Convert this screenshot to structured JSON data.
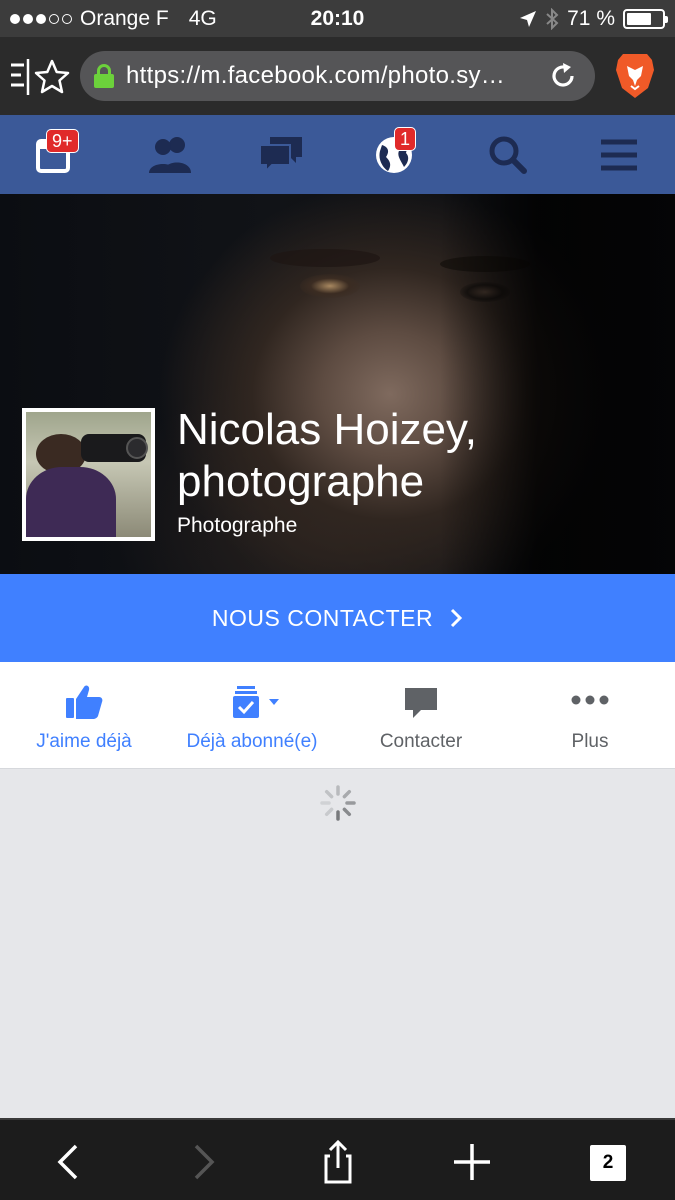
{
  "status_bar": {
    "carrier": "Orange F",
    "network": "4G",
    "time": "20:10",
    "battery": "71 %",
    "battery_level": 0.71,
    "signal_bars": 3
  },
  "browser": {
    "url": "https://m.facebook.com/photo.sy…",
    "icons": [
      "tabs-bookmark-icon",
      "lock-icon",
      "reload-icon",
      "brave-lion-icon"
    ]
  },
  "fb_nav": {
    "notifications_badge": "9+",
    "globe_badge": "1",
    "icons": [
      "feed-icon",
      "friends-icon",
      "messages-icon",
      "globe-icon",
      "search-icon",
      "menu-icon"
    ]
  },
  "page": {
    "name": "Nicolas Hoizey, photographe",
    "category": "Photographe",
    "contact_button": "NOUS CONTACTER"
  },
  "actions": [
    {
      "label": "J'aime déjà",
      "icon": "thumbs-up-icon",
      "color": "#4080ff"
    },
    {
      "label": "Déjà abonné(e)",
      "icon": "follow-check-icon",
      "color": "#4080ff"
    },
    {
      "label": "Contacter",
      "icon": "message-bubble-icon",
      "color": "#5f6266"
    },
    {
      "label": "Plus",
      "icon": "more-dots-icon",
      "color": "#5f6266"
    }
  ],
  "bottom_bar": {
    "tab_count": "2",
    "icons": [
      "back-icon",
      "forward-icon",
      "share-icon",
      "add-icon",
      "tabs-icon"
    ]
  },
  "colors": {
    "fb_blue": "#3b5998",
    "accent": "#4080ff",
    "badge_red": "#e02a2a"
  }
}
